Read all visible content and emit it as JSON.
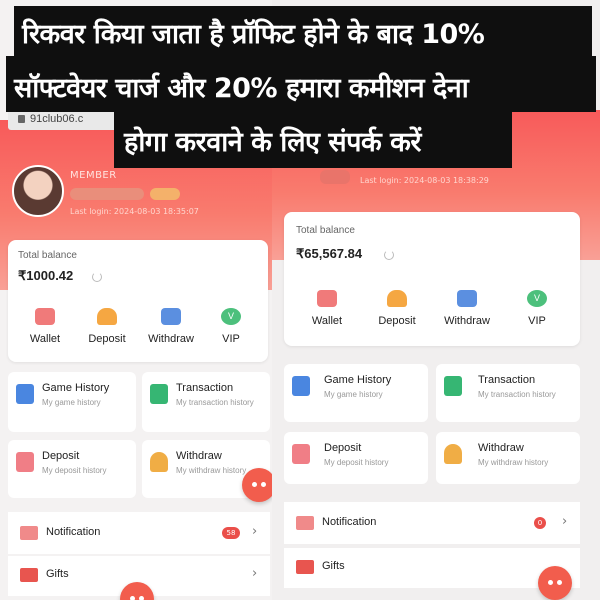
{
  "caption": {
    "line1": "रिकवर किया जाता है  प्रॉफिट होने के बाद 10%",
    "line2": "सॉफ्टवेयर चार्ज और 20% हमारा कमीशन देना",
    "line3": "होगा करवाने के लिए संपर्क करें"
  },
  "left": {
    "url": "91club06.c",
    "member": "MEMBER",
    "last_login": "Last login: 2024-08-03 18:35:07",
    "balance_label": "Total balance",
    "balance_value": "₹1000.42",
    "actions": [
      "Wallet",
      "Deposit",
      "Withdraw",
      "VIP"
    ],
    "tiles": [
      {
        "title": "Game History",
        "sub": "My game history"
      },
      {
        "title": "Transaction",
        "sub": "My transaction history"
      },
      {
        "title": "Deposit",
        "sub": "My deposit history"
      },
      {
        "title": "Withdraw",
        "sub": "My withdraw history"
      }
    ],
    "rows": [
      {
        "label": "Notification",
        "count": "58"
      },
      {
        "label": "Gifts"
      }
    ]
  },
  "right": {
    "last_login": "Last login: 2024-08-03 18:38:29",
    "balance_label": "Total balance",
    "balance_value": "₹65,567.84",
    "actions": [
      "Wallet",
      "Deposit",
      "Withdraw",
      "VIP"
    ],
    "tiles": [
      {
        "title": "Game History",
        "sub": "My game history"
      },
      {
        "title": "Transaction",
        "sub": "My transaction history"
      },
      {
        "title": "Deposit",
        "sub": "My deposit history"
      },
      {
        "title": "Withdraw",
        "sub": "My withdraw history"
      }
    ],
    "rows": [
      {
        "label": "Notification",
        "count": "0"
      },
      {
        "label": "Gifts"
      }
    ]
  },
  "icons": [
    "lock-icon",
    "refresh-icon",
    "wallet-icon",
    "deposit-icon",
    "withdraw-icon",
    "vip-icon",
    "game-history-icon",
    "transaction-icon",
    "deposit-history-icon",
    "withdraw-history-icon",
    "mail-icon",
    "gift-icon",
    "chevron-right-icon",
    "customer-service-icon"
  ],
  "colors": {
    "header": "#f85a5a",
    "accent": "#ea4f4a"
  }
}
